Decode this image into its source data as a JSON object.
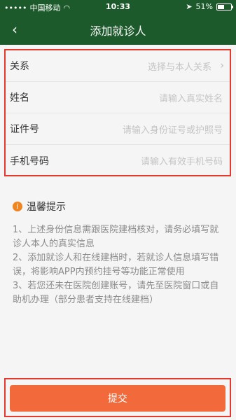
{
  "status_bar": {
    "carrier": "中国移动",
    "time": "10:33",
    "battery": "51%",
    "battery_level": 0.51
  },
  "nav": {
    "title": "添加就诊人",
    "back_icon": "chevron-left-icon"
  },
  "form": {
    "fields": [
      {
        "label": "关系",
        "placeholder": "选择与本人关系",
        "has_arrow": true
      },
      {
        "label": "姓名",
        "placeholder": "请输入真实姓名",
        "has_arrow": false
      },
      {
        "label": "证件号",
        "placeholder": "请输入身份证号或护照号",
        "has_arrow": false
      },
      {
        "label": "手机号码",
        "placeholder": "请输入有效手机号码",
        "has_arrow": false
      }
    ]
  },
  "tips": {
    "title": "温馨提示",
    "lines": [
      "1、上述身份信息需跟医院建档核对，请务必填写就诊人本人的真实信息",
      "2、添加就诊人和在线建档时，若就诊人信息填写错误，将影响APP内预约挂号等功能正常使用",
      "3、若您还未在医院创建账号，请先至医院窗口或自助机办理（部分患者支持在线建档）"
    ]
  },
  "submit": {
    "label": "提交"
  },
  "colors": {
    "header": "#1d5a2b",
    "accent": "#f26a3c",
    "highlight": "#e5392f"
  }
}
